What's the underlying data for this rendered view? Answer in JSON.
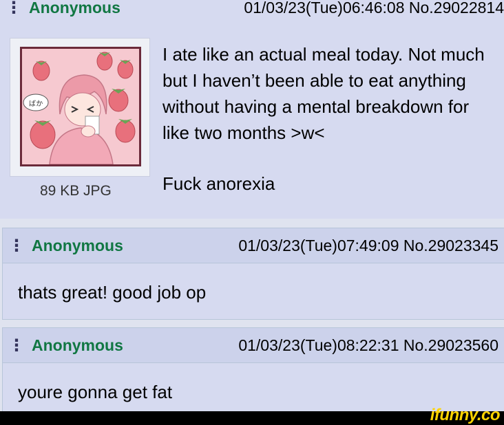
{
  "op": {
    "name": "Anonymous",
    "datetime": "01/03/23(Tue)06:46:08",
    "number": "No.29022814",
    "file_info": "89 KB JPG",
    "text": "I ate like an actual meal today. Not much but I haven’t been able to eat anything without having a mental breakdown for like two months >w<",
    "text2": "Fuck anorexia"
  },
  "replies": [
    {
      "name": "Anonymous",
      "datetime": "01/03/23(Tue)07:49:09",
      "number": "No.29023345",
      "text": "thats great! good job op"
    },
    {
      "name": "Anonymous",
      "datetime": "01/03/23(Tue)08:22:31",
      "number": "No.29023560",
      "text": "youre gonna get fat"
    }
  ],
  "thumbnail": {
    "caption_text": "ばか"
  },
  "watermark": "ifunny.co",
  "colors": {
    "name": "#117743",
    "post_bg": "#d6daf0",
    "header_bg": "#ccd2eb",
    "watermark": "#ffd400"
  }
}
